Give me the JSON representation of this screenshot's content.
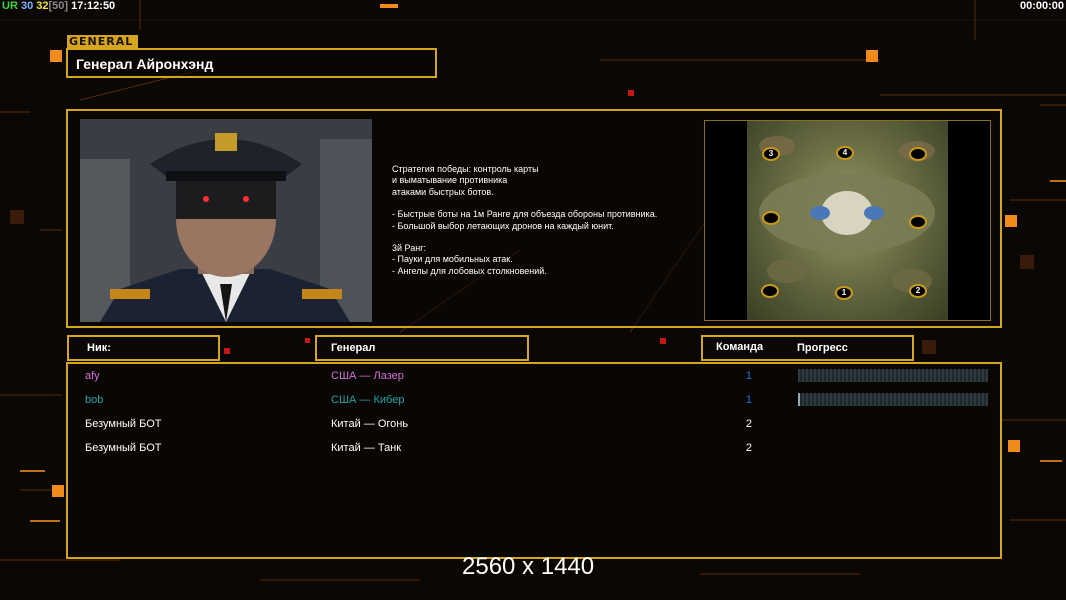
{
  "hud": {
    "ur_label": "UR",
    "ur_a": "30",
    "ur_b": "32",
    "ur_c": "[50]",
    "clock": "17:12:50",
    "timer": "00:00:00"
  },
  "tag": "GENERAL",
  "general_name": "Генерал Айронхэнд",
  "description": [
    "Стратегия победы: контроль карты",
    "и выматывание противника",
    "атаками быстрых ботов.",
    "",
    "- Быстрые боты на 1м Ранге для объезда обороны противника.",
    "- Большой выбор летающих дронов на каждый юнит.",
    "",
    "3й Ранг:",
    "- Пауки для мобильных атак.",
    "- Ангелы для лобовых столкновений."
  ],
  "map": {
    "spawns": [
      {
        "label": "3"
      },
      {
        "label": "4"
      },
      {
        "label": ""
      },
      {
        "label": ""
      },
      {
        "label": ""
      },
      {
        "label": ""
      },
      {
        "label": "1"
      },
      {
        "label": "2"
      }
    ]
  },
  "headers": {
    "nick": "Ник:",
    "general": "Генерал",
    "team": "Команда",
    "progress": "Прогресс"
  },
  "players": [
    {
      "nick": "afy",
      "general": "США — Лазер",
      "team": "1",
      "color": "#d173d9",
      "progress": 0.0,
      "show_progress": true
    },
    {
      "nick": "bob",
      "general": "США — Кибер",
      "team": "1",
      "color": "#1fa7a7",
      "progress": 0.01,
      "show_progress": true
    },
    {
      "nick": "Безумный БОТ",
      "general": "Китай — Огонь",
      "team": "2",
      "color": "#ffffff",
      "progress": 0,
      "show_progress": false
    },
    {
      "nick": "Безумный БОТ",
      "general": "Китай — Танк",
      "team": "2",
      "color": "#ffffff",
      "progress": 0,
      "show_progress": false
    }
  ],
  "resolution_label": "2560 x 1440",
  "colors": {
    "accent": "#d3a61c",
    "orange": "#f08a1a",
    "team_blue": "#2b6fd6"
  }
}
